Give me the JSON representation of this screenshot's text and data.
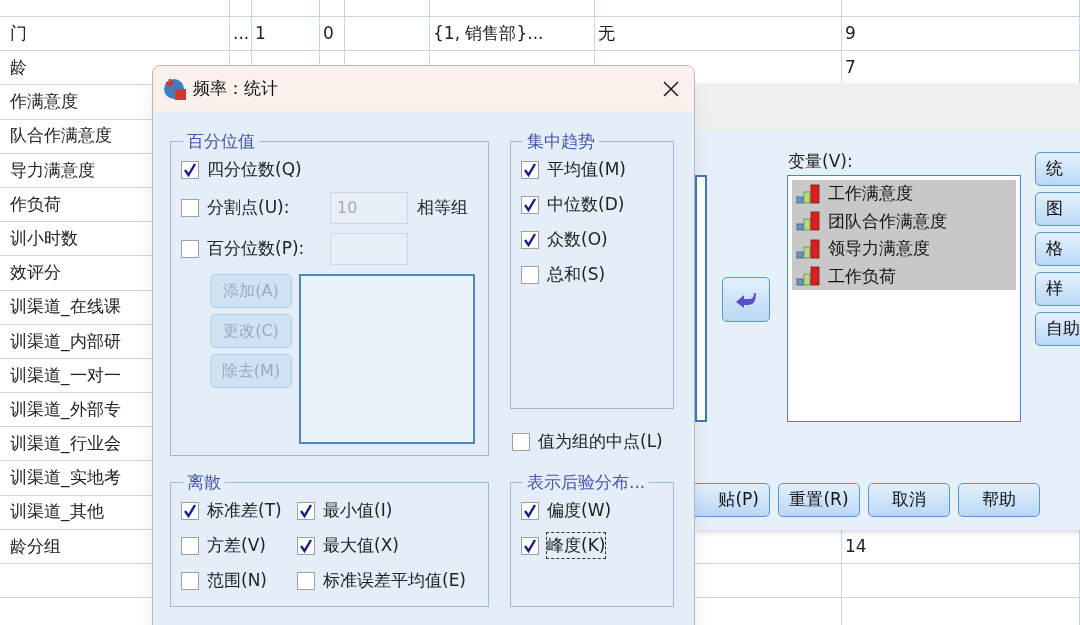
{
  "data_table": {
    "rows": [
      {
        "column_1": "门",
        "column_2": "...",
        "column_3": "1",
        "column_4": "0",
        "column_6": "{1, 销售部}...",
        "column_7": "无",
        "column_8": "9"
      },
      {
        "column_1": "龄",
        "column_8": "7"
      },
      {
        "column_1": "作满意度"
      },
      {
        "column_1": "队合作满意度"
      },
      {
        "column_1": "导力满意度"
      },
      {
        "column_1": "作负荷"
      },
      {
        "column_1": "训小时数"
      },
      {
        "column_1": "效评分"
      },
      {
        "column_1": "训渠道_在线课"
      },
      {
        "column_1": "训渠道_内部研"
      },
      {
        "column_1": "训渠道_一对一"
      },
      {
        "column_1": "训渠道_外部专"
      },
      {
        "column_1": "训渠道_行业会"
      },
      {
        "column_1": "训渠道_实地考"
      },
      {
        "column_1": "训渠道_其他"
      },
      {
        "column_1": "龄分组",
        "column_8": "14"
      }
    ]
  },
  "main_dialog": {
    "variables_label": "变量(V):",
    "variables": [
      {
        "label": "工作满意度",
        "selected": true
      },
      {
        "label": "团队合作满意度",
        "selected": true
      },
      {
        "label": "领导力满意度",
        "selected": true
      },
      {
        "label": "工作负荷",
        "selected": true
      }
    ],
    "side_buttons": [
      "统",
      "图",
      "格",
      "样",
      "自助"
    ],
    "bottom_buttons": [
      "贴(P)",
      "重置(R)",
      "取消",
      "帮助"
    ]
  },
  "stats_dialog": {
    "title": "频率：统计",
    "percentile_values": {
      "title": "百分位值",
      "quartiles": {
        "label": "四分位数(Q)",
        "checked": true
      },
      "cut_points": {
        "label": "分割点(U):",
        "checked": false,
        "value": "10",
        "disabled": true,
        "suffix": "相等组"
      },
      "percentiles": {
        "label": "百分位数(P):",
        "checked": false,
        "disabled": true
      },
      "buttons": [
        {
          "label": "添加(A)",
          "disabled": true
        },
        {
          "label": "更改(C)",
          "disabled": true
        },
        {
          "label": "除去(M)",
          "disabled": true
        }
      ]
    },
    "central_tendency": {
      "title": "集中趋势",
      "items": [
        {
          "label": "平均值(M)",
          "checked": true
        },
        {
          "label": "中位数(D)",
          "checked": true
        },
        {
          "label": "众数(O)",
          "checked": true
        },
        {
          "label": "总和(S)",
          "checked": false
        }
      ]
    },
    "midpoints": {
      "label": "值为组的中点(L)",
      "checked": false
    },
    "dispersion": {
      "title": "离散",
      "items": [
        {
          "label": "标准差(T)",
          "checked": true
        },
        {
          "label": "最小值(I)",
          "checked": true
        },
        {
          "label": "方差(V)",
          "checked": false
        },
        {
          "label": "最大值(X)",
          "checked": true
        },
        {
          "label": "范围(N)",
          "checked": false
        },
        {
          "label": "标准误差平均值(E)",
          "checked": false
        }
      ]
    },
    "distribution": {
      "title": "表示后验分布...",
      "items": [
        {
          "label": "偏度(W)",
          "checked": true,
          "focused": false
        },
        {
          "label": "峰度(K)",
          "checked": true,
          "focused": true
        }
      ]
    }
  }
}
